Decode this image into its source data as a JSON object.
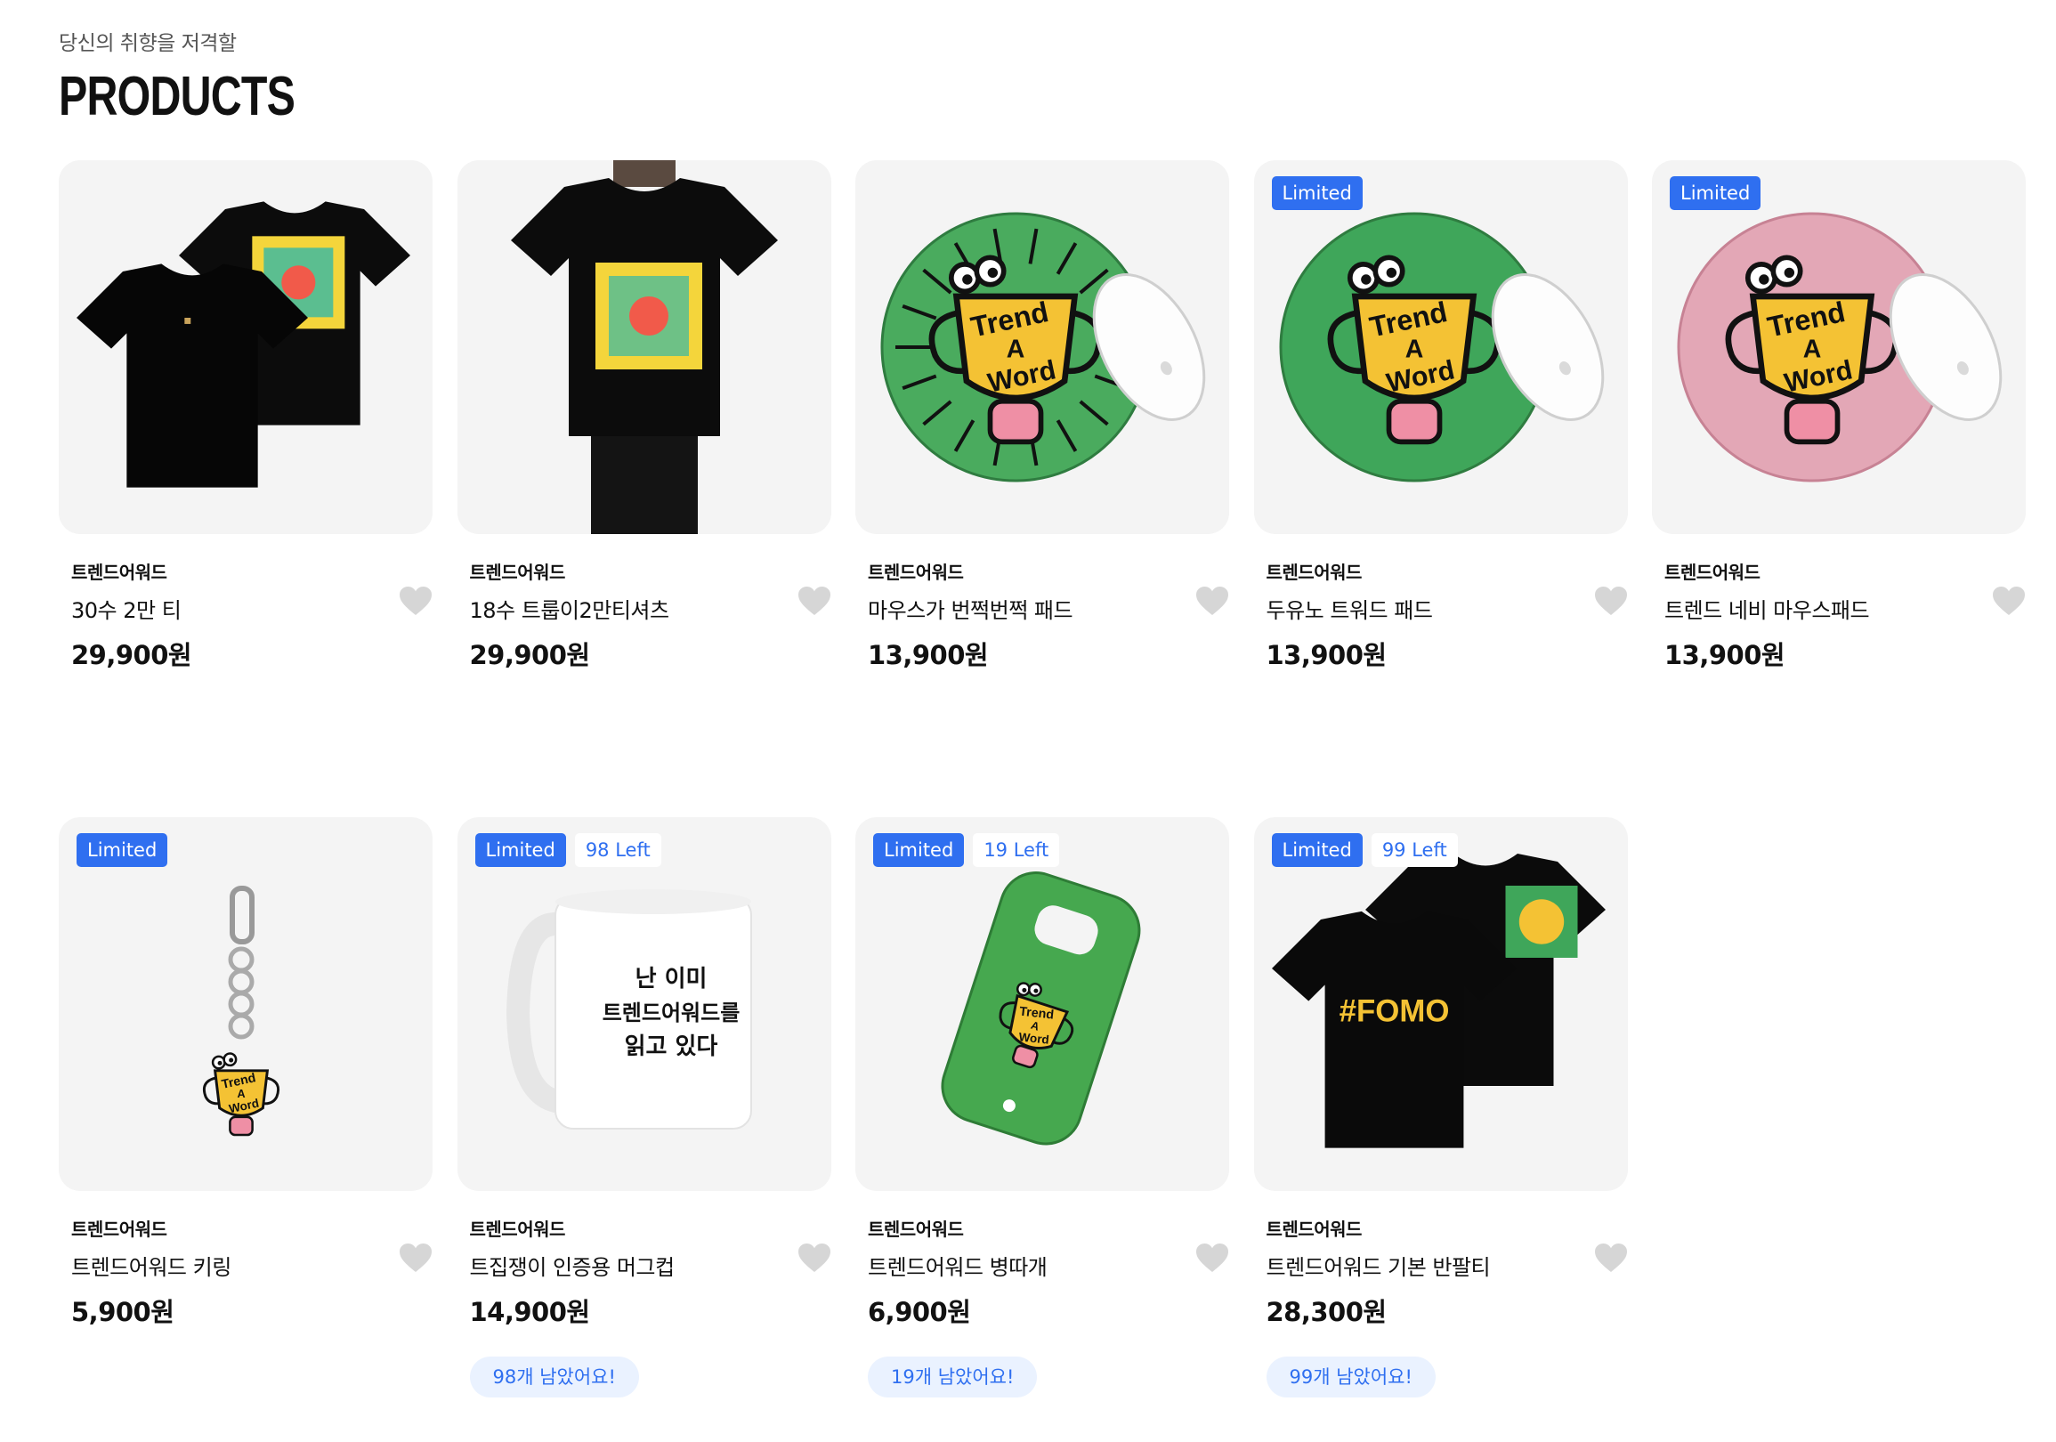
{
  "header": {
    "eyebrow": "당신의 취향을 저격할",
    "title": "PRODUCTS"
  },
  "colors": {
    "accent": "#2f6ff0",
    "stock_bg": "#eaf2ff",
    "thumb_bg": "#f4f4f4",
    "heart": "#d6d6d6"
  },
  "products": [
    {
      "brand": "트렌드어워드",
      "name": "30수 2만 티",
      "price": "29,900원",
      "badge": "",
      "left": "",
      "stock": "",
      "image": "tshirt-pair-icon"
    },
    {
      "brand": "트렌드어워드",
      "name": "18수 트룹이2만티셔츠",
      "price": "29,900원",
      "badge": "",
      "left": "",
      "stock": "",
      "image": "tshirt-model-icon"
    },
    {
      "brand": "트렌드어워드",
      "name": "마우스가 번쩍번쩍 패드",
      "price": "13,900원",
      "badge": "",
      "left": "",
      "stock": "",
      "image": "mousepad-green-rays-icon"
    },
    {
      "brand": "트렌드어워드",
      "name": "두유노 트워드 패드",
      "price": "13,900원",
      "badge": "Limited",
      "left": "",
      "stock": "",
      "image": "mousepad-green-icon"
    },
    {
      "brand": "트렌드어워드",
      "name": "트렌드 네비 마우스패드",
      "price": "13,900원",
      "badge": "Limited",
      "left": "",
      "stock": "",
      "image": "mousepad-pink-icon"
    },
    {
      "brand": "트렌드어워드",
      "name": "트렌드어워드 키링",
      "price": "5,900원",
      "badge": "Limited",
      "left": "",
      "stock": "",
      "image": "keyring-icon"
    },
    {
      "brand": "트렌드어워드",
      "name": "트집쟁이 인증용 머그컵",
      "price": "14,900원",
      "badge": "Limited",
      "left": "98 Left",
      "stock": "98개 남았어요!",
      "image": "mug-icon"
    },
    {
      "brand": "트렌드어워드",
      "name": "트렌드어워드 병따개",
      "price": "6,900원",
      "badge": "Limited",
      "left": "19 Left",
      "stock": "19개 남았어요!",
      "image": "bottle-opener-icon"
    },
    {
      "brand": "트렌드어워드",
      "name": "트렌드어워드 기본 반팔티",
      "price": "28,300원",
      "badge": "Limited",
      "left": "99 Left",
      "stock": "99개 남았어요!",
      "image": "tshirt-fomo-icon"
    }
  ],
  "artwork": {
    "logo_line1": "Trend",
    "logo_line2": "A",
    "logo_line3": "Word",
    "mug_text": [
      "난 이미",
      "트렌드어워드를",
      "읽고 있다"
    ],
    "fomo_text": "#FOMO"
  }
}
